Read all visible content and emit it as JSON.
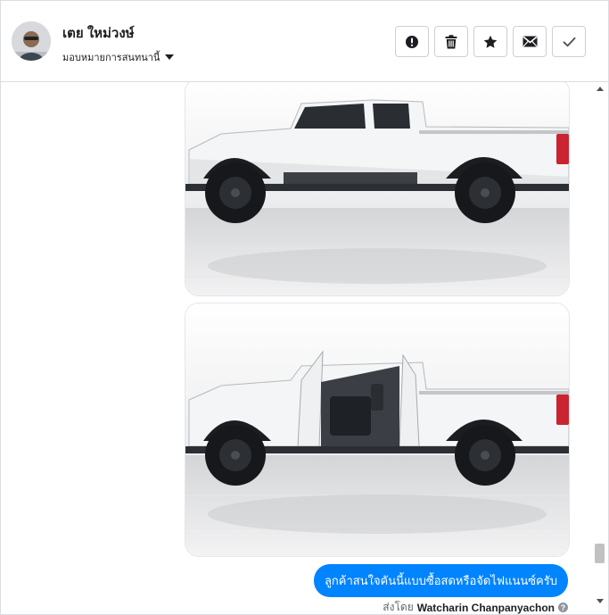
{
  "header": {
    "contact_name": "เตย ใหม่วงษ์",
    "assign_label": "มอบหมายการสนทนานี้",
    "actions": [
      {
        "icon": "alert-icon",
        "name": "mark-spam-button"
      },
      {
        "icon": "trash-icon",
        "name": "delete-button"
      },
      {
        "icon": "star-icon",
        "name": "star-button"
      },
      {
        "icon": "envelope-icon",
        "name": "mark-unread-button"
      },
      {
        "icon": "check-icon",
        "name": "mark-done-button"
      }
    ]
  },
  "thread": {
    "images": [
      {
        "subject": "white pickup truck side view, doors closed"
      },
      {
        "subject": "white pickup truck side view, doors open"
      }
    ],
    "message_text": "ลูกค้าสนใจคันนี้แบบซื้อสดหรือจัดไฟแนนซ์ครับ",
    "sent_by_label": "ส่งโดย",
    "sent_by_name": "Watcharin Chanpanyachon"
  },
  "colors": {
    "message_bubble": "#0084ff",
    "border": "#dadde1"
  }
}
